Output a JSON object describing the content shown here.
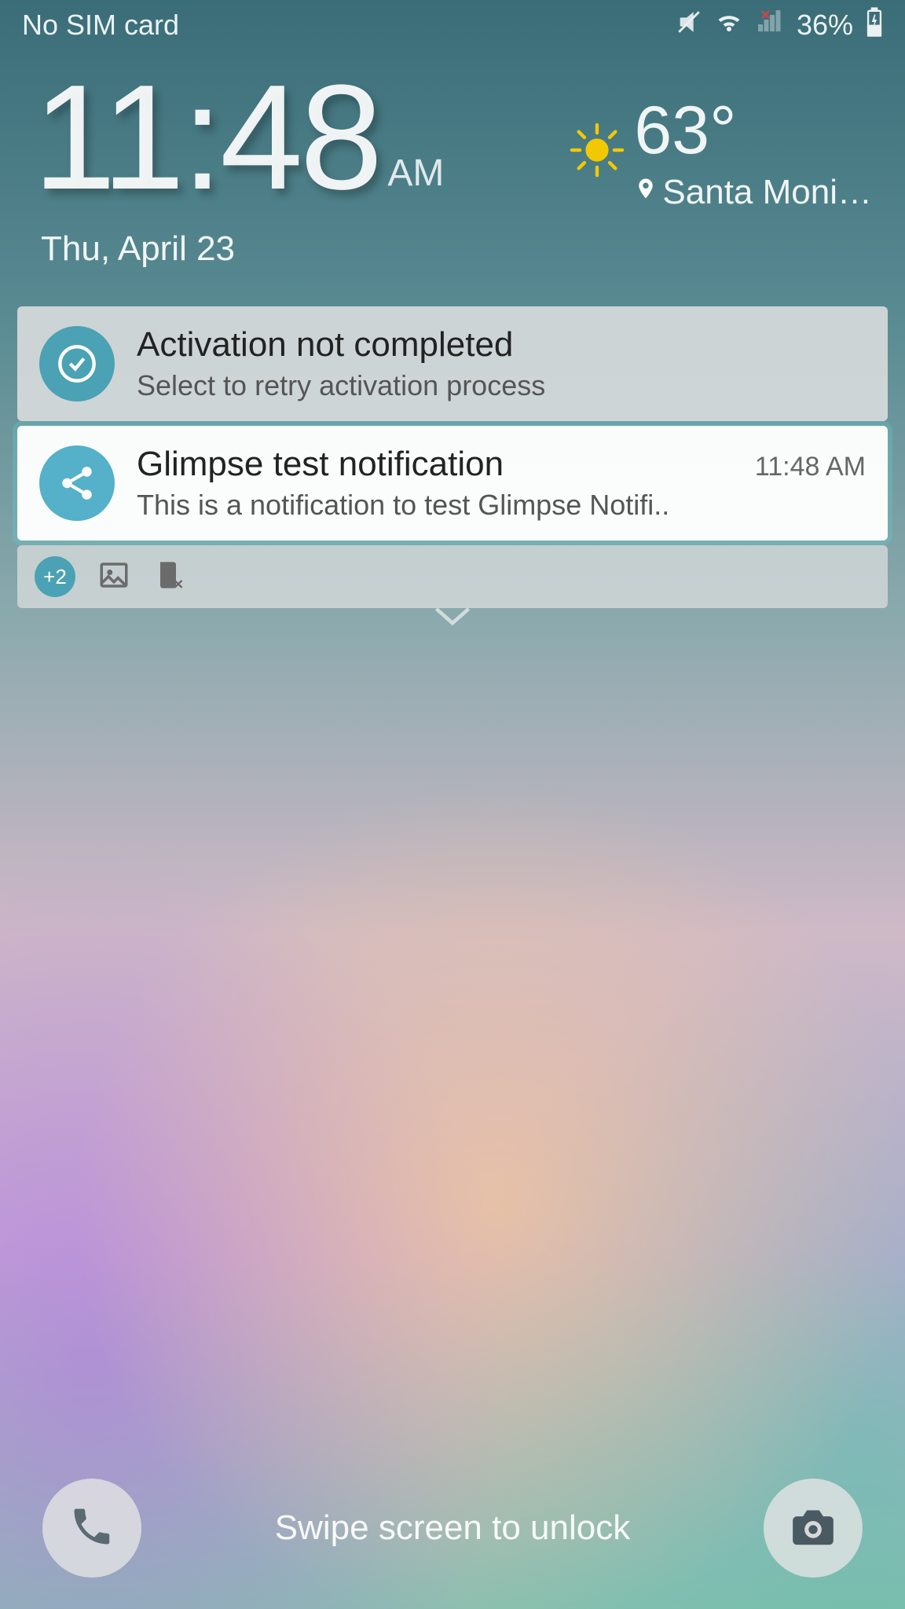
{
  "statusbar": {
    "carrier": "No SIM card",
    "battery_pct": "36%"
  },
  "clock": {
    "time": "11:48",
    "ampm": "AM",
    "date": "Thu, April 23"
  },
  "weather": {
    "temp": "63°",
    "location": "Santa Moni…"
  },
  "notifications": [
    {
      "icon": "check-circle",
      "title": "Activation not completed",
      "subtitle": "Select to retry activation process",
      "time": ""
    },
    {
      "icon": "share",
      "title": "Glimpse test notification",
      "subtitle": "This is a notification to test Glimpse Notifi..",
      "time": "11:48 AM"
    }
  ],
  "tray": {
    "more_badge": "+2"
  },
  "bottom": {
    "hint": "Swipe screen to unlock"
  }
}
